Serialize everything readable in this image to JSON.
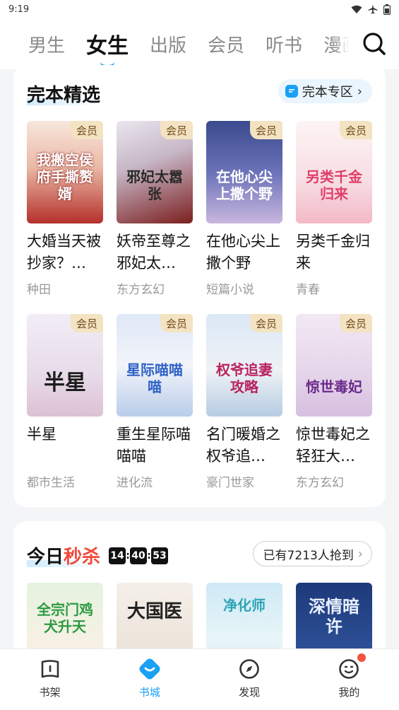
{
  "status_bar": {
    "time": "9:19"
  },
  "top_tabs": [
    "男生",
    "女生",
    "出版",
    "会员",
    "听书",
    "漫画"
  ],
  "active_tab": "女生",
  "section_complete": {
    "title": "完本精选",
    "zone_link": "完本专区",
    "vip_label": "会员",
    "books": [
      {
        "title": "大婚当天被抄家？…",
        "tag": "种田",
        "cover_text": "我搬空侯府手撕赘婿"
      },
      {
        "title": "妖帝至尊之邪妃太…",
        "tag": "东方玄幻",
        "cover_text": "邪妃太嚣张"
      },
      {
        "title": "在他心尖上撒个野",
        "tag": "短篇小说",
        "cover_text": "在他心尖上撒个野"
      },
      {
        "title": "另类千金归来",
        "tag": "青春",
        "cover_text": "另类千金归来"
      },
      {
        "title": "半星",
        "tag": "都市生活",
        "cover_text": "半星"
      },
      {
        "title": "重生星际喵喵喵",
        "tag": "进化流",
        "cover_text": "星际喵喵喵"
      },
      {
        "title": "名门暖婚之权爷追…",
        "tag": "豪门世家",
        "cover_text": "权爷追妻攻略"
      },
      {
        "title": "惊世毒妃之轻狂大…",
        "tag": "东方玄幻",
        "cover_text": "惊世毒妃"
      }
    ]
  },
  "section_flash": {
    "title_part1": "今日",
    "title_part2": "秒杀",
    "countdown": {
      "h": "14",
      "m": "40",
      "s": "53"
    },
    "grabbed_pill": "已有7213人抢到",
    "covers": [
      "全宗门鸡犬升天",
      "大国医",
      "净化师",
      "深情暗许"
    ]
  },
  "bottom_nav": [
    {
      "label": "书架"
    },
    {
      "label": "书城"
    },
    {
      "label": "发现"
    },
    {
      "label": "我的"
    }
  ],
  "colors": {
    "accent": "#1aa0f5",
    "sale_red": "#f04a3a",
    "vip_badge": "#f3e3c2"
  }
}
